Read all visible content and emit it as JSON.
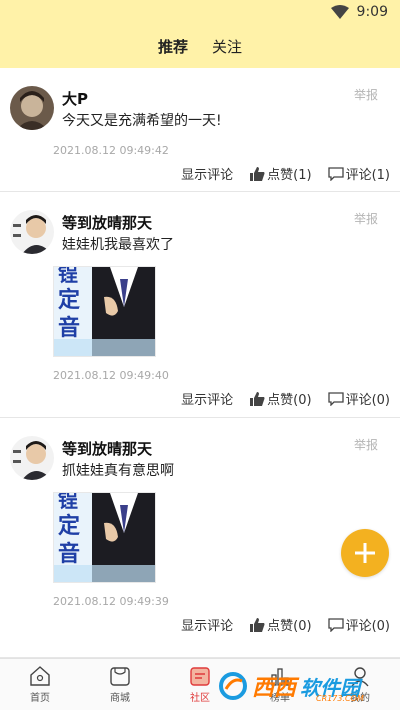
{
  "status_bar": {
    "time": "9:09"
  },
  "tabs": [
    {
      "label": "推荐",
      "active": true
    },
    {
      "label": "关注",
      "active": false
    }
  ],
  "posts": [
    {
      "author": "大P",
      "content": "今天又是充满希望的一天!",
      "timestamp": "2021.08.12 09:49:42",
      "report": "举报",
      "show_comments": "显示评论",
      "likes": "点赞(1)",
      "comments": "评论(1)",
      "has_image": false
    },
    {
      "author": "等到放晴那天",
      "content": "娃娃机我最喜欢了",
      "timestamp": "2021.08.12 09:49:40",
      "report": "举报",
      "show_comments": "显示评论",
      "likes": "点赞(0)",
      "comments": "评论(0)",
      "has_image": true,
      "image_text": "定音",
      "image_text_top": "锃"
    },
    {
      "author": "等到放晴那天",
      "content": "抓娃娃真有意思啊",
      "timestamp": "2021.08.12 09:49:39",
      "report": "举报",
      "show_comments": "显示评论",
      "likes": "点赞(0)",
      "comments": "评论(0)",
      "has_image": true,
      "image_text": "定音",
      "image_text_top": "锃"
    }
  ],
  "fab": {
    "icon": "plus-icon"
  },
  "bottom_nav": [
    {
      "label": "首页",
      "icon": "home-icon",
      "active": false
    },
    {
      "label": "商城",
      "icon": "store-icon",
      "active": false
    },
    {
      "label": "社区",
      "icon": "community-icon",
      "active": true
    },
    {
      "label": "榜单",
      "icon": "ranking-icon",
      "active": false
    },
    {
      "label": "我的",
      "icon": "profile-icon",
      "active": false
    }
  ],
  "watermark": {
    "brand": "西西",
    "brand2": "软件园",
    "url": "CR173.COM"
  },
  "colors": {
    "header_bg": "#fff2a8",
    "fab": "#f3b120",
    "active_nav": "#e03a3a"
  }
}
